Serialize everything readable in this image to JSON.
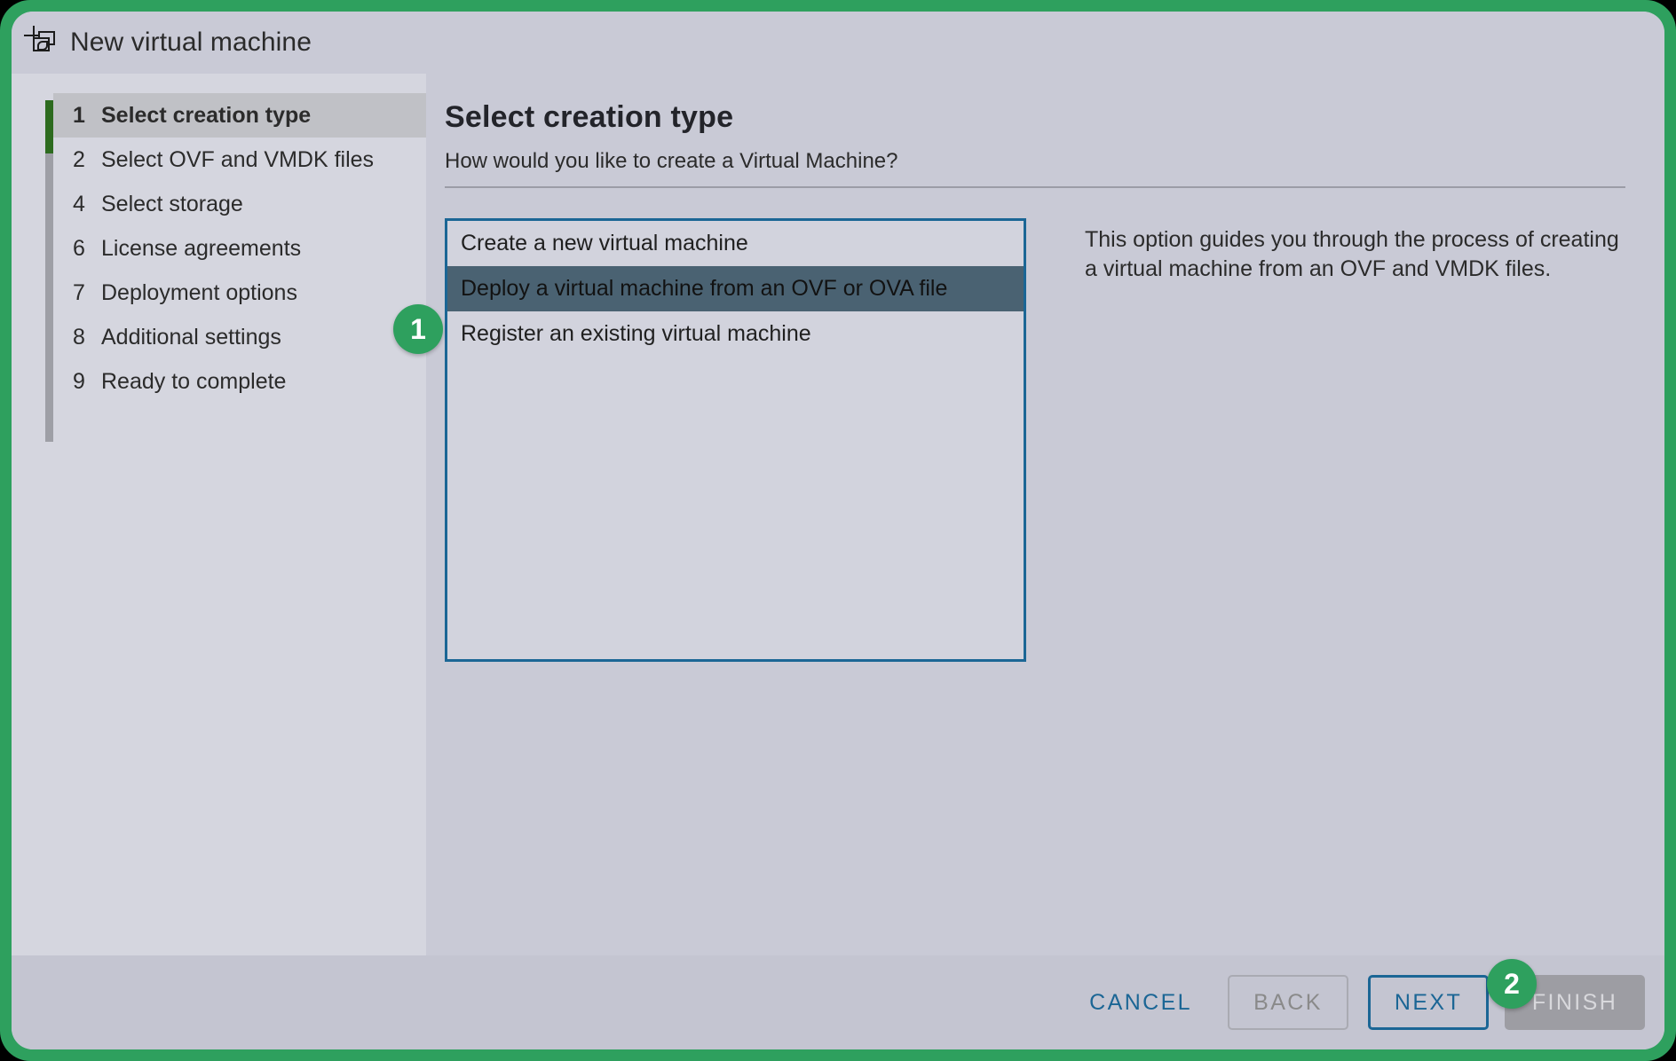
{
  "window": {
    "title": "New virtual machine",
    "icon": "new-vm-icon"
  },
  "sidebar": {
    "steps": [
      {
        "num": "1",
        "label": "Select creation type",
        "active": true
      },
      {
        "num": "2",
        "label": "Select OVF and VMDK files",
        "active": false
      },
      {
        "num": "4",
        "label": "Select storage",
        "active": false
      },
      {
        "num": "6",
        "label": "License agreements",
        "active": false
      },
      {
        "num": "7",
        "label": "Deployment options",
        "active": false
      },
      {
        "num": "8",
        "label": "Additional settings",
        "active": false
      },
      {
        "num": "9",
        "label": "Ready to complete",
        "active": false
      }
    ]
  },
  "main": {
    "title": "Select creation type",
    "subtitle": "How would you like to create a Virtual Machine?",
    "options": [
      {
        "label": "Create a new virtual machine",
        "selected": false
      },
      {
        "label": "Deploy a virtual machine from an OVF or OVA file",
        "selected": true
      },
      {
        "label": "Register an existing virtual machine",
        "selected": false
      }
    ],
    "description": "This option guides you through the process of creating a virtual machine from an OVF and VMDK files."
  },
  "footer": {
    "cancel": "CANCEL",
    "back": "BACK",
    "next": "NEXT",
    "finish": "FINISH"
  },
  "callouts": [
    {
      "number": "1"
    },
    {
      "number": "2"
    }
  ],
  "colors": {
    "accent_green": "#2ea05e",
    "progress_green": "#2d6b1f",
    "link_blue": "#1b6695",
    "selected_row": "#4a6272",
    "dialog_bg": "#c9cad6",
    "sidebar_bg": "#d5d6df"
  }
}
